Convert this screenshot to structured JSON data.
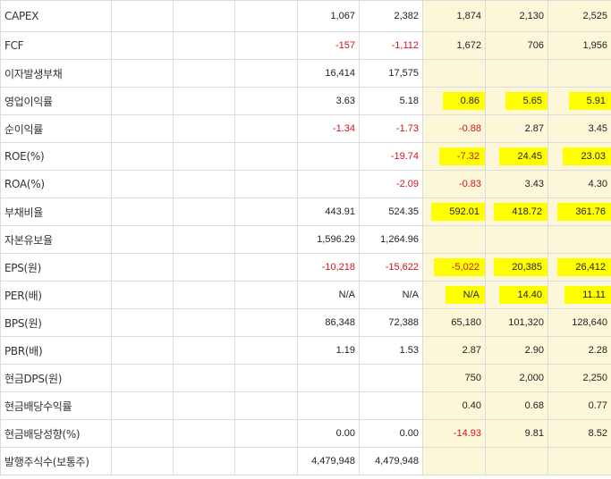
{
  "colors": {
    "estimate_bg": "#fdf7d9",
    "negative": "#d2141e",
    "highlight": "#ffff00"
  },
  "rows": [
    {
      "label": "CAPEX",
      "values": [
        "",
        "",
        "",
        "1,067",
        "2,382",
        "1,874",
        "2,130",
        "2,525"
      ]
    },
    {
      "label": "FCF",
      "values": [
        "",
        "",
        "",
        "-157",
        "-1,112",
        "1,672",
        "706",
        "1,956"
      ]
    },
    {
      "label": "이자발생부채",
      "values": [
        "",
        "",
        "",
        "16,414",
        "17,575",
        "",
        "",
        ""
      ]
    },
    {
      "label": "영업이익률",
      "values": [
        "",
        "",
        "",
        "3.63",
        "5.18",
        "0.86",
        "5.65",
        "5.91"
      ]
    },
    {
      "label": "순이익률",
      "values": [
        "",
        "",
        "",
        "-1.34",
        "-1.73",
        "-0.88",
        "2.87",
        "3.45"
      ]
    },
    {
      "label": "ROE(%)",
      "values": [
        "",
        "",
        "",
        "",
        "-19.74",
        "-7.32",
        "24.45",
        "23.03"
      ]
    },
    {
      "label": "ROA(%)",
      "values": [
        "",
        "",
        "",
        "",
        "-2.09",
        "-0.83",
        "3.43",
        "4.30"
      ]
    },
    {
      "label": "부채비율",
      "values": [
        "",
        "",
        "",
        "443.91",
        "524.35",
        "592.01",
        "418.72",
        "361.76"
      ]
    },
    {
      "label": "자본유보율",
      "values": [
        "",
        "",
        "",
        "1,596.29",
        "1,264.96",
        "",
        "",
        ""
      ]
    },
    {
      "label": "EPS(원)",
      "values": [
        "",
        "",
        "",
        "-10,218",
        "-15,622",
        "-5,022",
        "20,385",
        "26,412"
      ]
    },
    {
      "label": "PER(배)",
      "values": [
        "",
        "",
        "",
        "N/A",
        "N/A",
        "N/A",
        "14.40",
        "11.11"
      ]
    },
    {
      "label": "BPS(원)",
      "values": [
        "",
        "",
        "",
        "86,348",
        "72,388",
        "65,180",
        "101,320",
        "128,640"
      ]
    },
    {
      "label": "PBR(배)",
      "values": [
        "",
        "",
        "",
        "1.19",
        "1.53",
        "2.87",
        "2.90",
        "2.28"
      ]
    },
    {
      "label": "현금DPS(원)",
      "values": [
        "",
        "",
        "",
        "",
        "",
        "750",
        "2,000",
        "2,250"
      ]
    },
    {
      "label": "현금배당수익률",
      "values": [
        "",
        "",
        "",
        "",
        "",
        "0.40",
        "0.68",
        "0.77"
      ]
    },
    {
      "label": "현금배당성향(%)",
      "values": [
        "",
        "",
        "",
        "0.00",
        "0.00",
        "-14.93",
        "9.81",
        "8.52"
      ]
    },
    {
      "label": "발행주식수(보통주)",
      "values": [
        "",
        "",
        "",
        "4,479,948",
        "4,479,948",
        "",
        "",
        ""
      ]
    }
  ]
}
